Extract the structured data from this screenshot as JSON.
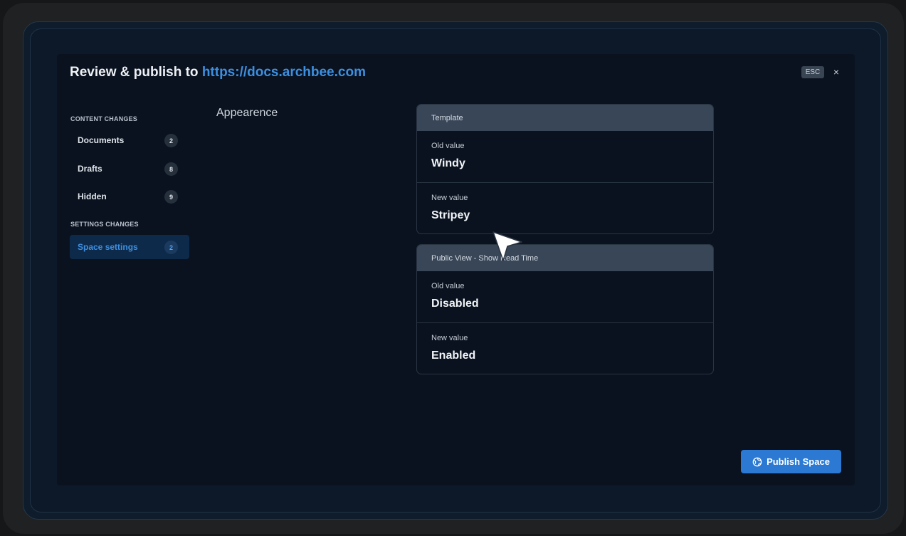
{
  "modal": {
    "title_prefix": "Review & publish to",
    "title_url": "https://docs.archbee.com",
    "esc_label": "ESC",
    "close_glyph": "×"
  },
  "sidebar": {
    "content_section_label": "CONTENT CHANGES",
    "settings_section_label": "SETTINGS CHANGES",
    "items": [
      {
        "label": "Documents",
        "count": "2"
      },
      {
        "label": "Drafts",
        "count": "8"
      },
      {
        "label": "Hidden",
        "count": "9"
      },
      {
        "label": "Space settings",
        "count": "2",
        "active": true
      }
    ]
  },
  "main": {
    "heading": "Appearence",
    "cards": [
      {
        "header": "Template",
        "old_label": "Old value",
        "old_value": "Windy",
        "new_label": "New value",
        "new_value": "Stripey"
      },
      {
        "header": "Public View - Show Read Time",
        "old_label": "Old value",
        "old_value": "Disabled",
        "new_label": "New value",
        "new_value": "Enabled"
      }
    ]
  },
  "footer": {
    "publish_label": "Publish Space",
    "publish_icon": "globe-icon"
  },
  "colors": {
    "accent": "#2b79d3",
    "link": "#3d8fe0",
    "modal_bg": "#0a121f",
    "card_header_bg": "#394657"
  }
}
